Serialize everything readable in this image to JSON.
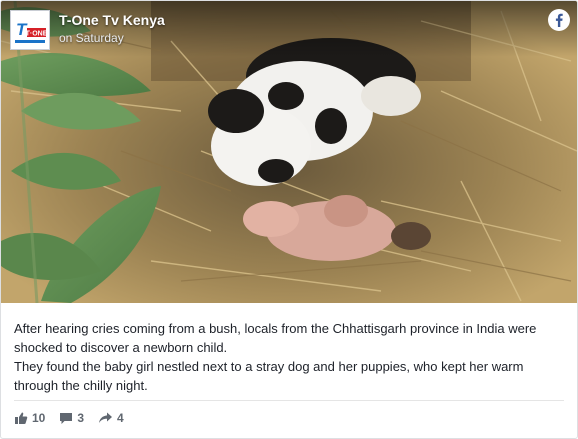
{
  "header": {
    "page_name": "T-One Tv Kenya",
    "timestamp": "on Saturday",
    "avatar_text": "T·ONE",
    "avatar_icon": "t-one-logo-icon",
    "platform_icon": "facebook-icon"
  },
  "media": {
    "image_subject": "photo-dogs-and-newborn-in-straw",
    "accent_colors": {
      "straw": "#b89a5e",
      "leaf": "#5f8f52"
    }
  },
  "caption": {
    "line1": "After hearing cries coming from a bush, locals from the Chhattisgarh province in India were shocked to discover a newborn child.",
    "line2": "They found the baby girl nestled next to a stray dog and her puppies, who kept her warm through the chilly night."
  },
  "actions": {
    "likes": "10",
    "comments": "3",
    "shares": "4",
    "like_icon": "thumbs-up-icon",
    "comment_icon": "comment-icon",
    "share_icon": "share-arrow-icon"
  },
  "colors": {
    "facebook_blue": "#3b5998",
    "text": "#1d2129",
    "muted": "#606770",
    "border": "#dddfe2"
  }
}
